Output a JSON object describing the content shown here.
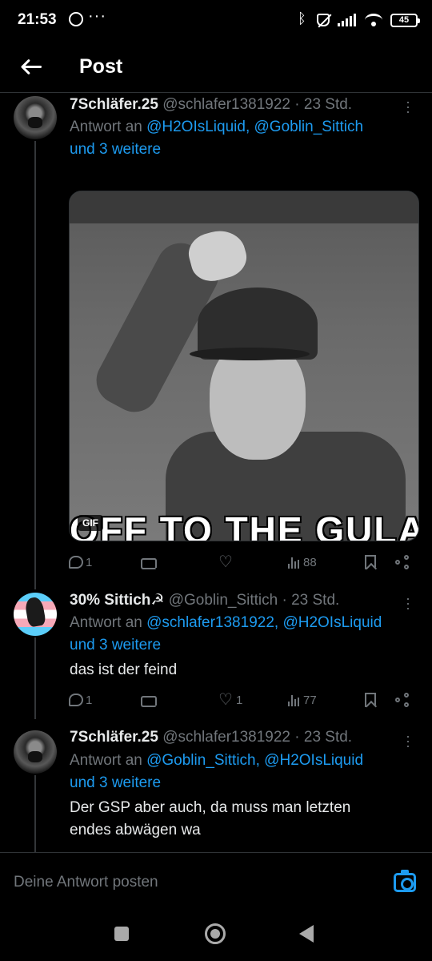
{
  "status_bar": {
    "time": "21:53",
    "dots": "···",
    "battery": "45"
  },
  "header": {
    "title": "Post"
  },
  "tweets": [
    {
      "name": "7Schläfer.25",
      "handle": "@schlafer1381922 · 23 Std.",
      "reply_prefix": "Antwort an ",
      "reply_targets": "@H2OIsLiquid, @Goblin_Sittich",
      "reply_suffix": "und 3 weitere",
      "media": {
        "caption": "OFF TO THE GULAG",
        "badge": "GIF"
      },
      "stats": {
        "replies": "1",
        "reposts": "",
        "likes": "",
        "views": "88"
      }
    },
    {
      "name": "30% Sittich☭",
      "handle": "@Goblin_Sittich · 23 Std.",
      "reply_prefix": "Antwort an ",
      "reply_targets": "@schlafer1381922, @H2OIsLiquid",
      "reply_suffix": "und 3 weitere",
      "text": "das ist der feind",
      "stats": {
        "replies": "1",
        "reposts": "",
        "likes": "1",
        "views": "77"
      }
    },
    {
      "name": "7Schläfer.25",
      "handle": "@schlafer1381922 · 23 Std.",
      "reply_prefix": "Antwort an ",
      "reply_targets": "@Goblin_Sittich, @H2OIsLiquid",
      "reply_suffix": "und 3 weitere",
      "text": "Der GSP aber auch, da muss man letzten endes abwägen wa"
    }
  ],
  "composer": {
    "placeholder": "Deine Antwort posten"
  },
  "colors": {
    "background": "#000000",
    "link": "#1d9bf0",
    "muted": "#71767b",
    "text": "#e7e9ea"
  }
}
